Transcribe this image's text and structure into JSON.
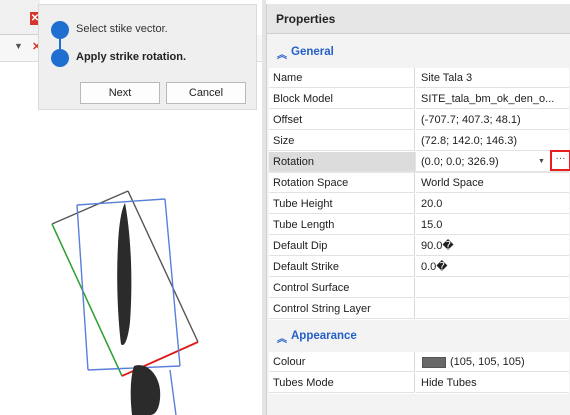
{
  "wizard": {
    "steps": [
      "Select stike vector.",
      "Apply strike rotation."
    ],
    "next_label": "Next",
    "cancel_label": "Cancel"
  },
  "viewport": {
    "tab_close_glyph": "✕",
    "dropdown_glyph": "▼",
    "close_glyph": "✕"
  },
  "properties": {
    "title": "Properties",
    "sections": [
      {
        "name": "General",
        "rows": [
          {
            "key": "Name",
            "value": "Site Tala 3"
          },
          {
            "key": "Block Model",
            "value": "SITE_tala_bm_ok_den_o..."
          },
          {
            "key": "Offset",
            "value": "(-707.7; 407.3; 48.1)"
          },
          {
            "key": "Size",
            "value": "(72.8; 142.0; 146.3)"
          },
          {
            "key": "Rotation",
            "value": "(0.0; 0.0; 326.9)"
          },
          {
            "key": "Rotation Space",
            "value": "World Space"
          },
          {
            "key": "Tube Height",
            "value": "20.0"
          },
          {
            "key": "Tube Length",
            "value": "15.0"
          },
          {
            "key": "Default Dip",
            "value": "90.0�"
          },
          {
            "key": "Default Strike",
            "value": "0.0�"
          },
          {
            "key": "Control Surface",
            "value": ""
          },
          {
            "key": "Control String Layer",
            "value": ""
          }
        ]
      },
      {
        "name": "Appearance",
        "rows": [
          {
            "key": "Colour",
            "value": "(105, 105, 105)"
          },
          {
            "key": "Tubes Mode",
            "value": "Hide Tubes"
          }
        ]
      }
    ],
    "rotation_more_glyph": "···",
    "rotation_dropdown_glyph": "▼",
    "chevron_glyph": "︽"
  },
  "colors": {
    "accent": "#1f6fd1",
    "section_title": "#2560c8",
    "highlight_box": "#e81f1f",
    "swatch": "#696969"
  }
}
